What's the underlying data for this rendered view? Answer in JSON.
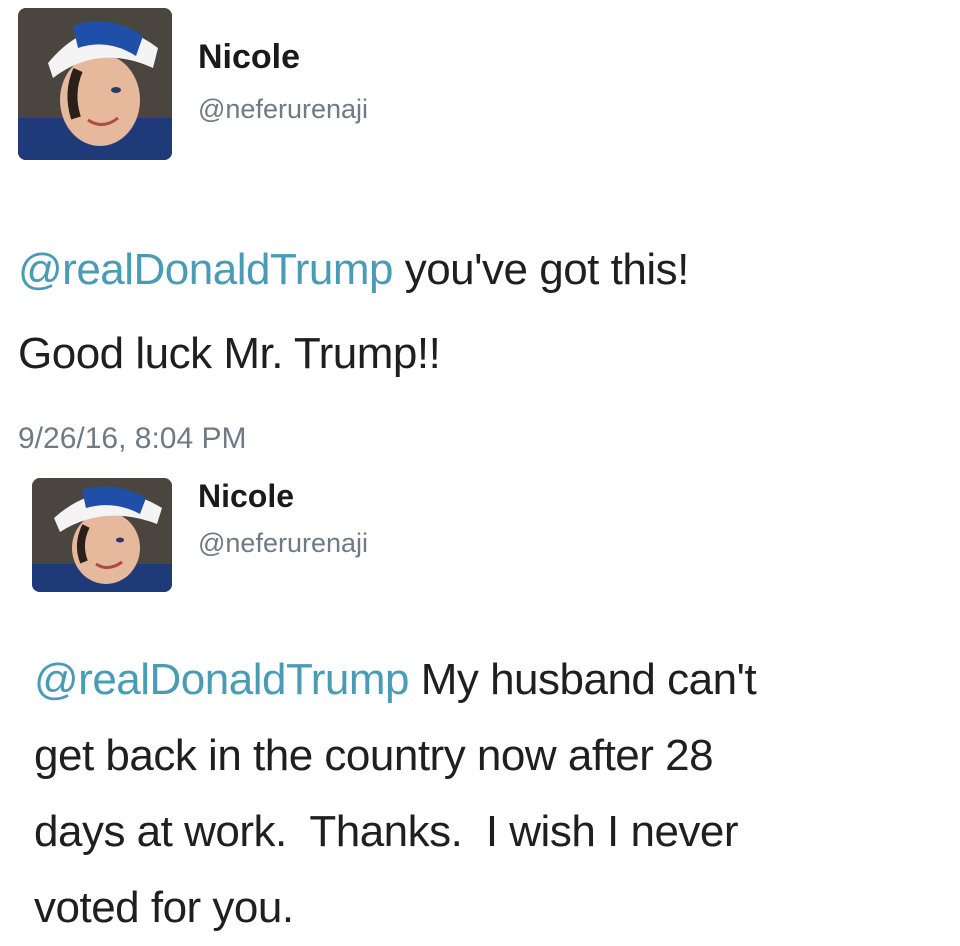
{
  "colors": {
    "mention": "#4a9bb5",
    "handle": "#6f7a84",
    "text": "#1f1f1f"
  },
  "tweets": [
    {
      "name": "Nicole",
      "handle": "@neferurenaji",
      "avatar_icon": "profile-photo",
      "mention": "@realDonaldTrump",
      "body_line1_rest": " you've got this!",
      "body_line2": "Good luck Mr. Trump!!",
      "timestamp": "9/26/16, 8:04 PM"
    },
    {
      "name": "Nicole",
      "handle": "@neferurenaji",
      "avatar_icon": "profile-photo",
      "mention": "@realDonaldTrump",
      "body_line1_rest": " My husband can't",
      "body_line2": "get back in the country now after 28",
      "body_line3": "days at work.  Thanks.  I wish I never",
      "body_line4": "voted for you."
    }
  ]
}
